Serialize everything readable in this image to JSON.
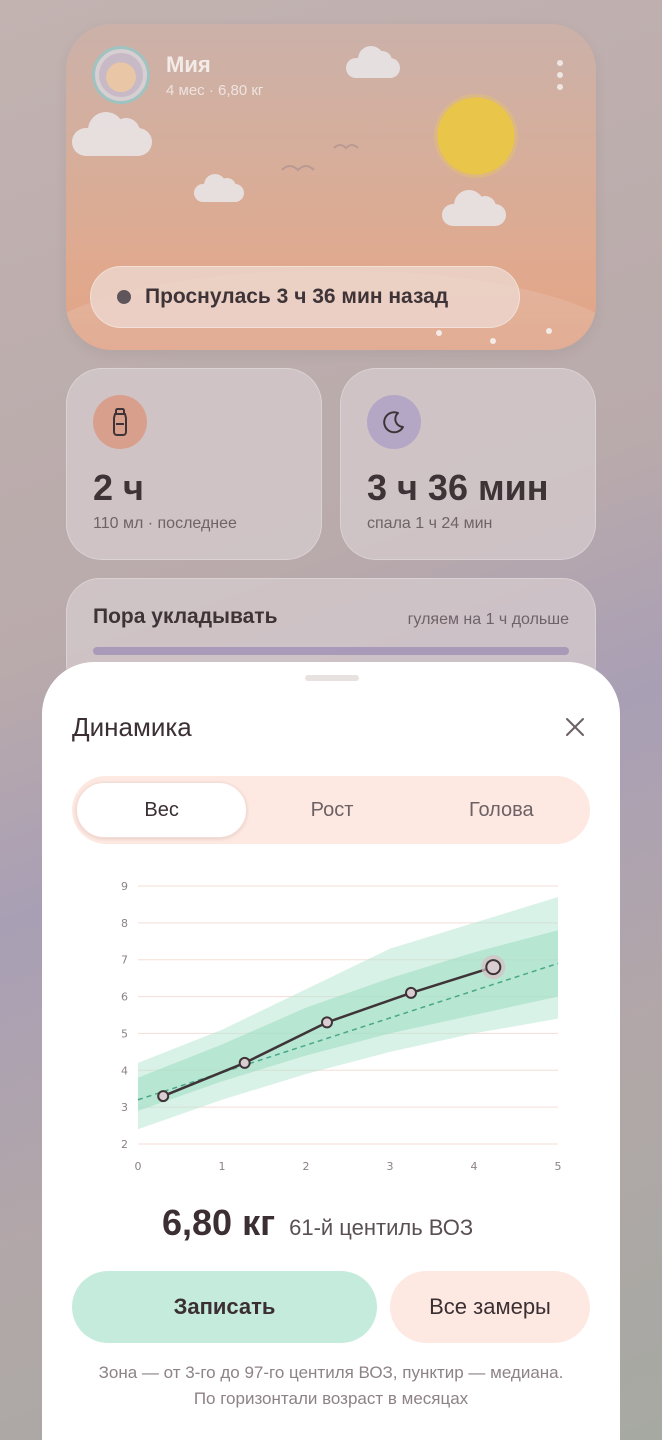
{
  "profile": {
    "name": "Мия",
    "meta": "4 мес · 6,80 кг"
  },
  "status": {
    "text": "Проснулась 3 ч 36 мин назад"
  },
  "stats": {
    "feeding": {
      "value": "2 ч",
      "detail": "110 мл · последнее",
      "icon": "bottle-icon"
    },
    "sleep": {
      "value": "3 ч 36 мин",
      "detail": "спала 1 ч 24 мин",
      "icon": "moon-icon"
    }
  },
  "bedtime": {
    "title": "Пора укладывать",
    "note": "гуляем на 1 ч дольше"
  },
  "sheet": {
    "title": "Динамика",
    "tabs": [
      {
        "label": "Вес",
        "active": true
      },
      {
        "label": "Рост",
        "active": false
      },
      {
        "label": "Голова",
        "active": false
      }
    ],
    "reading": {
      "value": "6,80 кг",
      "centile": "61-й центиль ВОЗ"
    },
    "record_button": "Записать",
    "all_button": "Все замеры",
    "footnote": "Зона — от 3-го до 97-го центиля ВОЗ, пунктир — медиана. По горизонтали возраст в месяцах"
  },
  "colors": {
    "accent_mint": "#c5ebdd",
    "accent_peach": "#fde9e2",
    "line": "#3e3438",
    "median": "#4aa88a"
  },
  "chart_data": {
    "type": "line",
    "x_ticks": [
      0,
      1,
      2,
      3,
      4,
      5
    ],
    "y_ticks": [
      2,
      3,
      4,
      5,
      6,
      7,
      8,
      9
    ],
    "xlim": [
      0,
      5
    ],
    "ylim": [
      2,
      9
    ],
    "grid": true,
    "series": [
      {
        "x": [
          0.3,
          1.27,
          2.25,
          3.25,
          4.23
        ],
        "values": [
          3.3,
          4.2,
          5.3,
          6.1,
          6.8
        ]
      }
    ],
    "median": {
      "x": [
        0,
        5
      ],
      "values": [
        3.2,
        6.9
      ]
    },
    "band_outer": {
      "x": [
        0,
        1,
        2,
        3,
        4,
        5
      ],
      "lower": [
        2.4,
        3.2,
        3.9,
        4.5,
        5.0,
        5.4
      ],
      "upper": [
        4.2,
        5.1,
        6.2,
        7.3,
        8.0,
        8.7
      ]
    },
    "band_inner": {
      "x": [
        0,
        1,
        2,
        3,
        4,
        5
      ],
      "lower": [
        2.9,
        3.7,
        4.4,
        5.0,
        5.5,
        6.0
      ],
      "upper": [
        3.8,
        4.7,
        5.7,
        6.5,
        7.2,
        7.8
      ]
    },
    "highlight_index": 4
  }
}
